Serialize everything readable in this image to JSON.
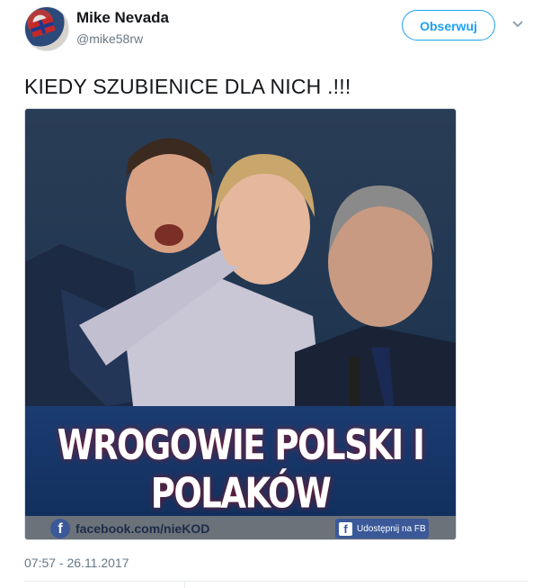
{
  "author": {
    "name": "Mike Nevada",
    "handle": "@mike58rw"
  },
  "follow_label": "Obserwuj",
  "more_icon": "chevron-down-icon",
  "tweet_text": "KIEDY SZUBIENICE DLA NICH .!!!",
  "media": {
    "headline": "WROGOWIE POLSKI I POLAKÓW",
    "footer_link": "facebook.com/nieKOD",
    "share_label": "Udostępnij na FB",
    "fb_glyph": "f",
    "colors": {
      "background": "#0f2240",
      "footer": "#6b727a",
      "facebook": "#3b5998"
    }
  },
  "timestamp": "07:57 - 26.11.2017",
  "colors": {
    "accent": "#1da1f2",
    "text": "#14171a",
    "muted": "#657786"
  }
}
